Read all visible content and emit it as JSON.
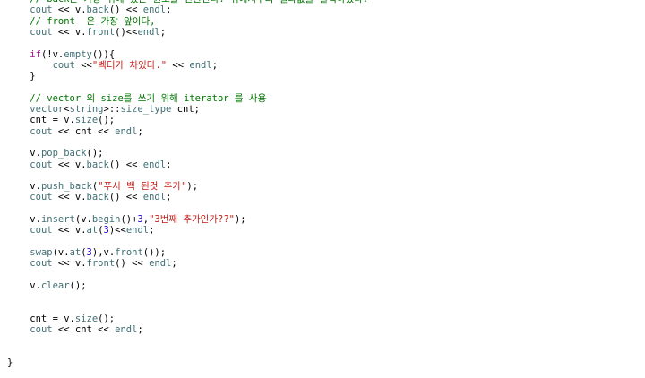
{
  "editor": {
    "language": "cpp",
    "colors": {
      "background": "#ffffff",
      "comment": "#007400",
      "keyword": "#aa0d91",
      "identifier": "#3f6e74",
      "string": "#c41a16",
      "number": "#1c00cf",
      "plain": "#000000"
    },
    "lines": [
      [
        [
          "c",
          "    // back은 가장 뒤에 있는 원소를 반환한다. 뒤에서부터 결과값을 출력하였다."
        ]
      ],
      [
        [
          "p",
          "    "
        ],
        [
          "t",
          "cout"
        ],
        [
          "p",
          " << v."
        ],
        [
          "t",
          "back"
        ],
        [
          "p",
          "() << "
        ],
        [
          "t",
          "endl"
        ],
        [
          "p",
          ";"
        ]
      ],
      [
        [
          "c",
          "    // front  은 가장 앞이다,"
        ]
      ],
      [
        [
          "p",
          "    "
        ],
        [
          "t",
          "cout"
        ],
        [
          "p",
          " << v."
        ],
        [
          "t",
          "front"
        ],
        [
          "p",
          "()<<"
        ],
        [
          "t",
          "endl"
        ],
        [
          "p",
          ";"
        ]
      ],
      [],
      [
        [
          "p",
          "    "
        ],
        [
          "k",
          "if"
        ],
        [
          "p",
          "(!v."
        ],
        [
          "t",
          "empty"
        ],
        [
          "p",
          "()){"
        ]
      ],
      [
        [
          "p",
          "        "
        ],
        [
          "t",
          "cout"
        ],
        [
          "p",
          " <<"
        ],
        [
          "s",
          "\"벡터가 차있다.\""
        ],
        [
          "p",
          " << "
        ],
        [
          "t",
          "endl"
        ],
        [
          "p",
          ";"
        ]
      ],
      [
        [
          "p",
          "    }"
        ]
      ],
      [],
      [
        [
          "c",
          "    // vector 의 size를 쓰기 위해 iterator 를 사용"
        ]
      ],
      [
        [
          "p",
          "    "
        ],
        [
          "t",
          "vector"
        ],
        [
          "p",
          "<"
        ],
        [
          "t",
          "string"
        ],
        [
          "p",
          ">::"
        ],
        [
          "t",
          "size_type"
        ],
        [
          "p",
          " cnt;"
        ]
      ],
      [
        [
          "p",
          "    cnt = v."
        ],
        [
          "t",
          "size"
        ],
        [
          "p",
          "();"
        ]
      ],
      [
        [
          "p",
          "    "
        ],
        [
          "t",
          "cout"
        ],
        [
          "p",
          " << cnt << "
        ],
        [
          "t",
          "endl"
        ],
        [
          "p",
          ";"
        ]
      ],
      [],
      [
        [
          "p",
          "    v."
        ],
        [
          "t",
          "pop_back"
        ],
        [
          "p",
          "();"
        ]
      ],
      [
        [
          "p",
          "    "
        ],
        [
          "t",
          "cout"
        ],
        [
          "p",
          " << v."
        ],
        [
          "t",
          "back"
        ],
        [
          "p",
          "() << "
        ],
        [
          "t",
          "endl"
        ],
        [
          "p",
          ";"
        ]
      ],
      [],
      [
        [
          "p",
          "    v."
        ],
        [
          "t",
          "push_back"
        ],
        [
          "p",
          "("
        ],
        [
          "s",
          "\"푸시 백 된것 추가\""
        ],
        [
          "p",
          ");"
        ]
      ],
      [
        [
          "p",
          "    "
        ],
        [
          "t",
          "cout"
        ],
        [
          "p",
          " << v."
        ],
        [
          "t",
          "back"
        ],
        [
          "p",
          "() << "
        ],
        [
          "t",
          "endl"
        ],
        [
          "p",
          ";"
        ]
      ],
      [],
      [
        [
          "p",
          "    v."
        ],
        [
          "t",
          "insert"
        ],
        [
          "p",
          "(v."
        ],
        [
          "t",
          "begin"
        ],
        [
          "p",
          "()+"
        ],
        [
          "n",
          "3"
        ],
        [
          "p",
          ","
        ],
        [
          "s",
          "\"3번째 추가인가??\""
        ],
        [
          "p",
          ");"
        ]
      ],
      [
        [
          "p",
          "    "
        ],
        [
          "t",
          "cout"
        ],
        [
          "p",
          " << v."
        ],
        [
          "t",
          "at"
        ],
        [
          "p",
          "("
        ],
        [
          "n",
          "3"
        ],
        [
          "p",
          ")<<"
        ],
        [
          "t",
          "endl"
        ],
        [
          "p",
          ";"
        ]
      ],
      [],
      [
        [
          "p",
          "    "
        ],
        [
          "t",
          "swap"
        ],
        [
          "p",
          "(v."
        ],
        [
          "t",
          "at"
        ],
        [
          "p",
          "("
        ],
        [
          "n",
          "3"
        ],
        [
          "p",
          "),v."
        ],
        [
          "t",
          "front"
        ],
        [
          "p",
          "());"
        ]
      ],
      [
        [
          "p",
          "    "
        ],
        [
          "t",
          "cout"
        ],
        [
          "p",
          " << v."
        ],
        [
          "t",
          "front"
        ],
        [
          "p",
          "() << "
        ],
        [
          "t",
          "endl"
        ],
        [
          "p",
          ";"
        ]
      ],
      [],
      [
        [
          "p",
          "    v."
        ],
        [
          "t",
          "clear"
        ],
        [
          "p",
          "();"
        ]
      ],
      [],
      [],
      [
        [
          "p",
          "    cnt = v."
        ],
        [
          "t",
          "size"
        ],
        [
          "p",
          "();"
        ]
      ],
      [
        [
          "p",
          "    "
        ],
        [
          "t",
          "cout"
        ],
        [
          "p",
          " << cnt << "
        ],
        [
          "t",
          "endl"
        ],
        [
          "p",
          ";"
        ]
      ],
      [],
      [],
      [
        [
          "p",
          "}"
        ]
      ]
    ]
  }
}
